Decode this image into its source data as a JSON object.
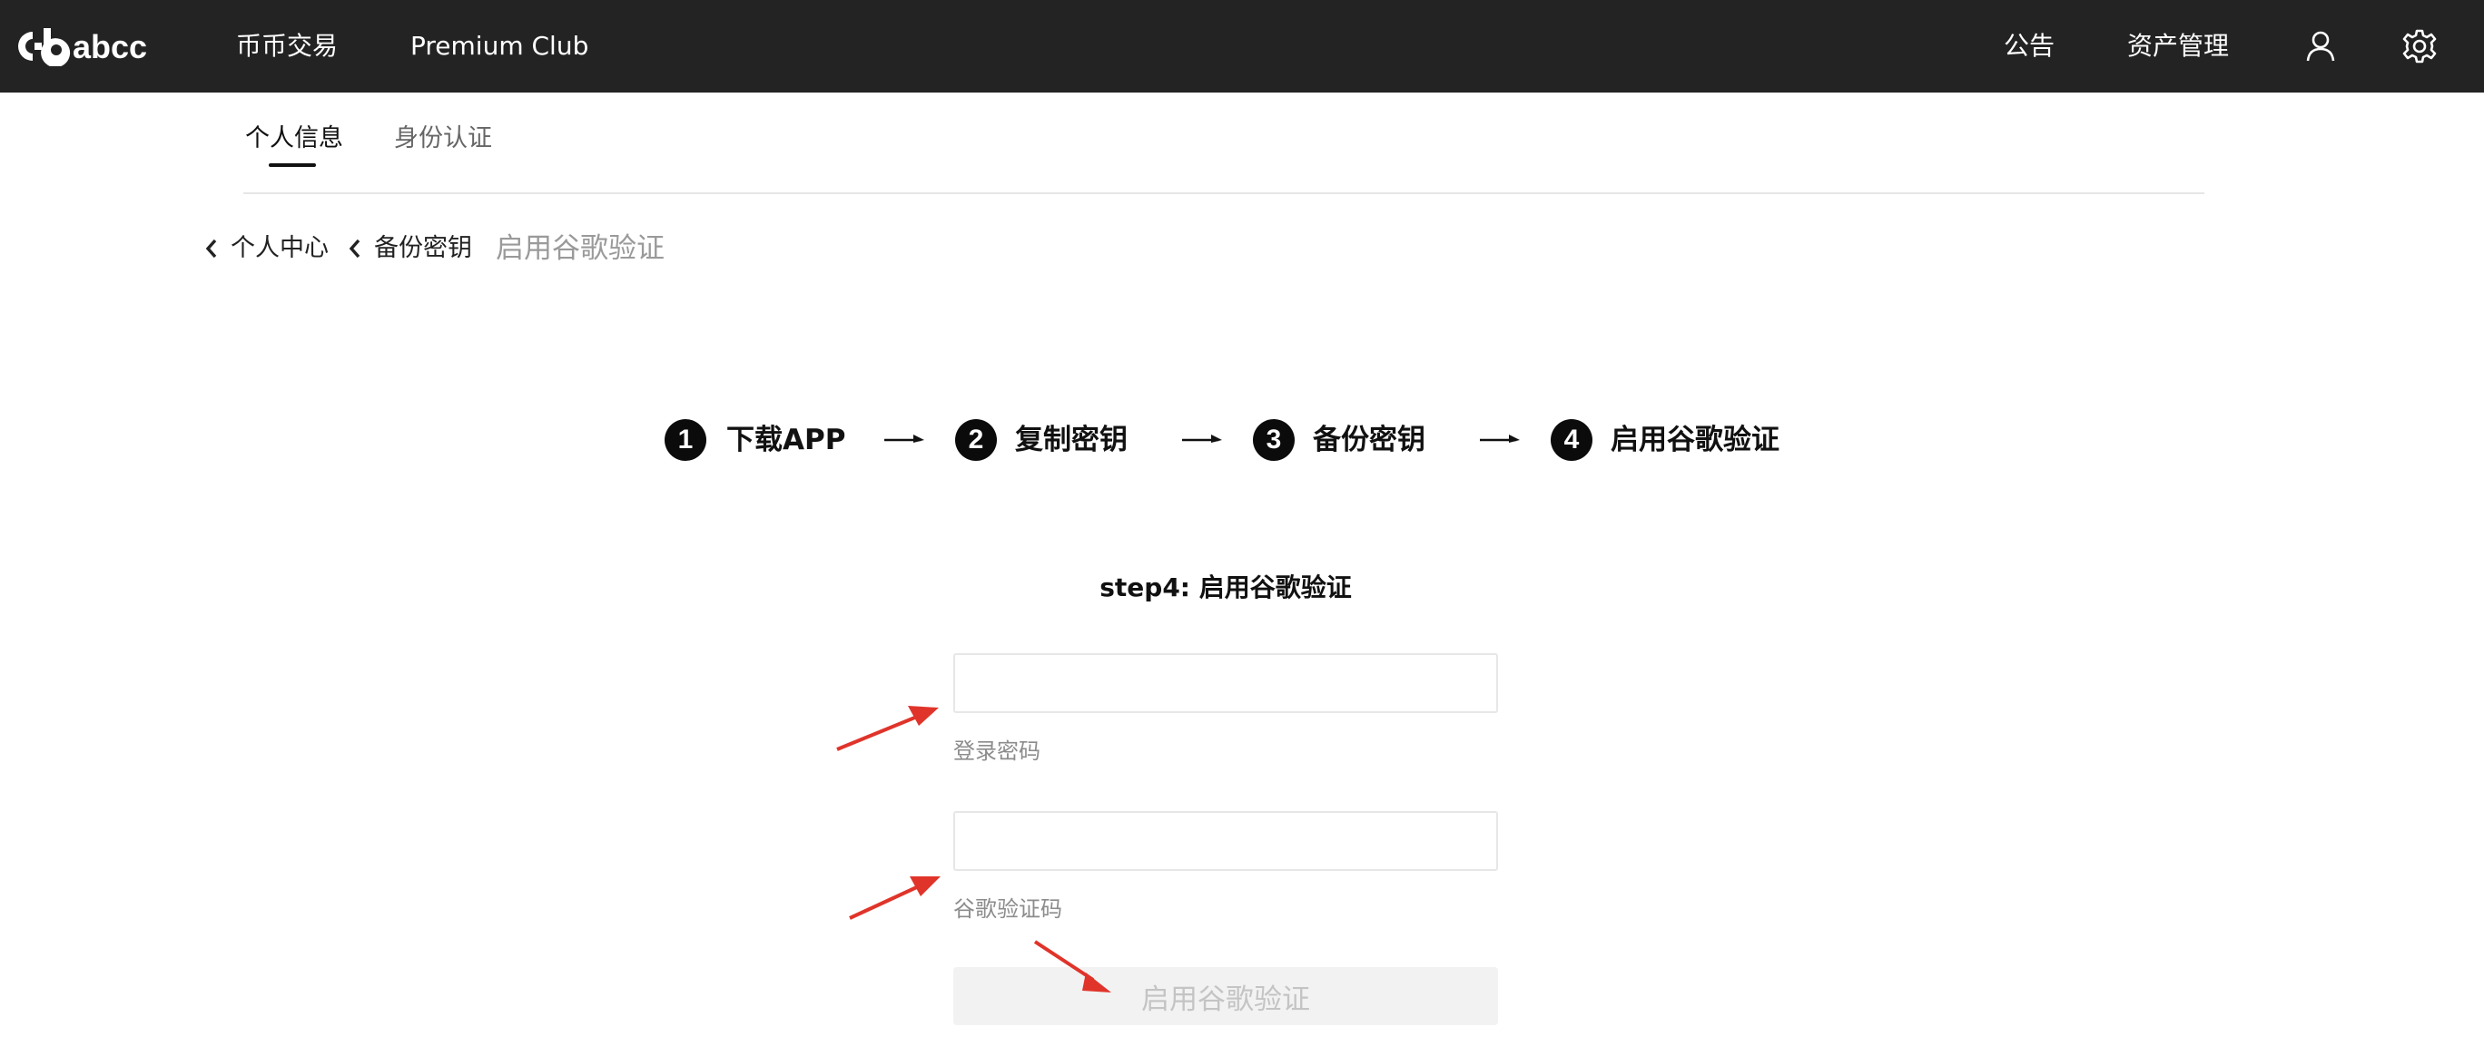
{
  "header": {
    "logo_text": "abcc",
    "nav": [
      "币币交易",
      "Premium Club"
    ],
    "right_nav": [
      "公告",
      "资产管理"
    ],
    "icons": [
      "user-icon",
      "gear-icon"
    ]
  },
  "tabs": [
    {
      "label": "个人信息",
      "active": true
    },
    {
      "label": "身份认证",
      "active": false
    }
  ],
  "breadcrumb": {
    "items": [
      "个人中心",
      "备份密钥"
    ],
    "current": "启用谷歌验证"
  },
  "stepper": {
    "steps": [
      {
        "number": "1",
        "label": "下载APP"
      },
      {
        "number": "2",
        "label": "复制密钥"
      },
      {
        "number": "3",
        "label": "备份密钥"
      },
      {
        "number": "4",
        "label": "启用谷歌验证"
      }
    ]
  },
  "form": {
    "title": "step4: 启用谷歌验证",
    "password_value": "",
    "password_label": "登录密码",
    "code_value": "",
    "code_label": "谷歌验证码",
    "submit_label": "启用谷歌验证"
  },
  "colors": {
    "header_bg": "#232323",
    "annotation_arrow": "#e0342a",
    "disabled_button_bg": "#f2f2f2"
  }
}
